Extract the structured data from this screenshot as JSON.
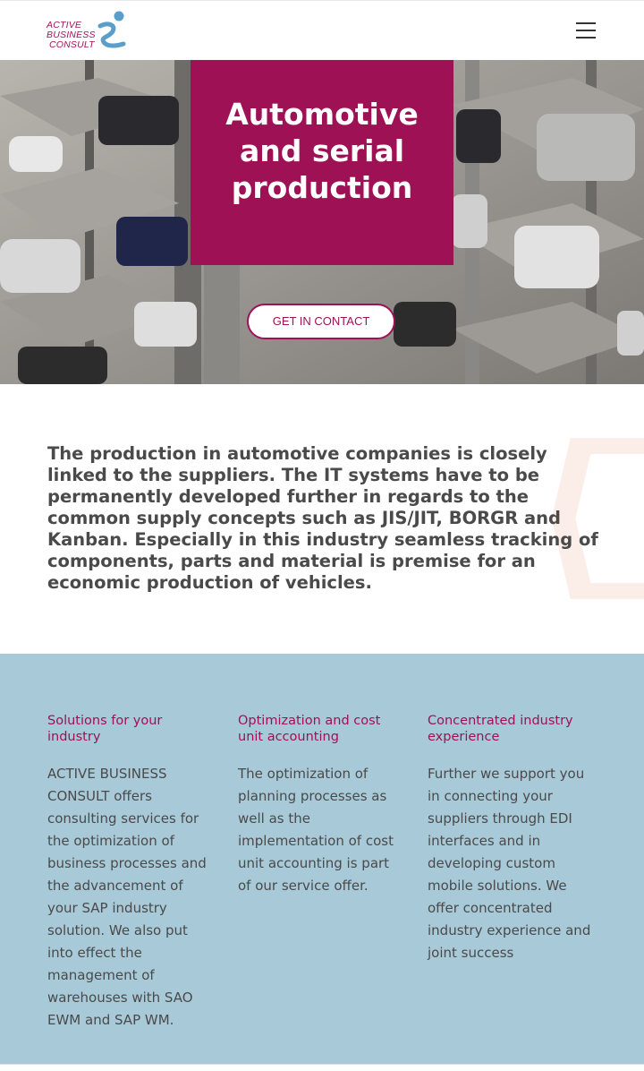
{
  "header": {
    "logo_lines": [
      "ACTIVE",
      "BUSINESS",
      "CONSULT"
    ],
    "menu_icon": "hamburger-menu-icon"
  },
  "hero": {
    "title": "Automotive and serial production",
    "cta_label": "GET IN CONTACT"
  },
  "intro": {
    "text": "The production in automotive companies is closely linked to the suppliers. The IT systems have to be permanently developed further in regards to the common supply concepts such as JIS/JIT, BORGR and Kanban. Especially in this industry seamless tracking of components, parts and material is premise for an economic production of vehicles."
  },
  "features": [
    {
      "title": "Solutions for your industry",
      "text": "ACTIVE BUSINESS CONSULT offers consulting services for the optimization of business processes and the advancement of your SAP industry solution. We also put into effect the management of warehouses with SAO EWM and SAP WM."
    },
    {
      "title": "Optimization and cost unit accounting",
      "text": "The optimization of planning processes as well as the implementation of cost unit accounting is part of our service offer."
    },
    {
      "title": "Concentrated industry experience",
      "text": "Further we support you in connecting your suppliers through EDI interfaces and in developing custom mobile solutions. We offer concentrated industry experience and joint success"
    }
  ],
  "colors": {
    "brand": "#9e1255",
    "logo_blue": "#5b9ec9",
    "features_bg": "#a8c9d8"
  }
}
